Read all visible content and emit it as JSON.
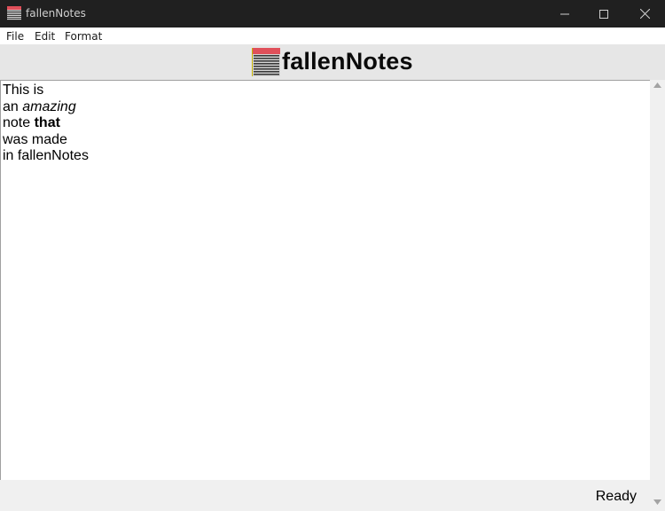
{
  "window": {
    "title": "fallenNotes",
    "icon": "notes-app-icon"
  },
  "menu": {
    "items": [
      {
        "label": "File"
      },
      {
        "label": "Edit"
      },
      {
        "label": "Format"
      }
    ]
  },
  "header": {
    "logo_icon": "notes-logo-icon",
    "title": "fallenNotes"
  },
  "editor": {
    "lines": [
      {
        "normal": "This is"
      },
      {
        "prefix": "an ",
        "italic": "amazing"
      },
      {
        "prefix": "note ",
        "bold": "that"
      },
      {
        "normal": "was made"
      },
      {
        "normal": "in fallenNotes"
      }
    ]
  },
  "status": {
    "text": "Ready"
  },
  "colors": {
    "titlebar": "#202020",
    "logo_red": "#e0505a",
    "logo_stripe": "#3a3a3a"
  }
}
